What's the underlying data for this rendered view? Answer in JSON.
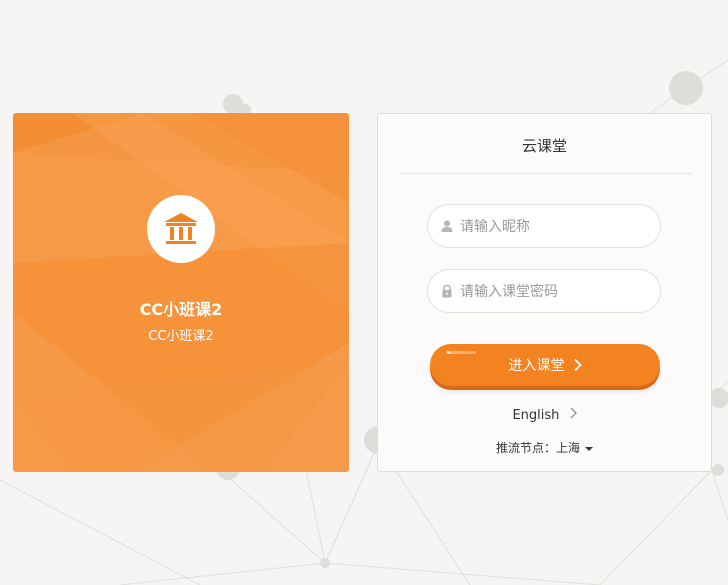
{
  "room": {
    "name": "CC小班课2",
    "subtitle": "CC小班课2",
    "logo_icon": "classroom-building-icon"
  },
  "login": {
    "title": "云课堂",
    "nickname_placeholder": "请输入昵称",
    "nickname_value": "",
    "password_placeholder": "请输入课堂密码",
    "password_value": "",
    "enter_label": "进入课堂",
    "language_label": "English",
    "node_label": "推流节点：",
    "node_value": "上海"
  },
  "colors": {
    "brand_orange": "#f6953f",
    "button_orange": "#f28320",
    "background": "#f6f5f3"
  }
}
